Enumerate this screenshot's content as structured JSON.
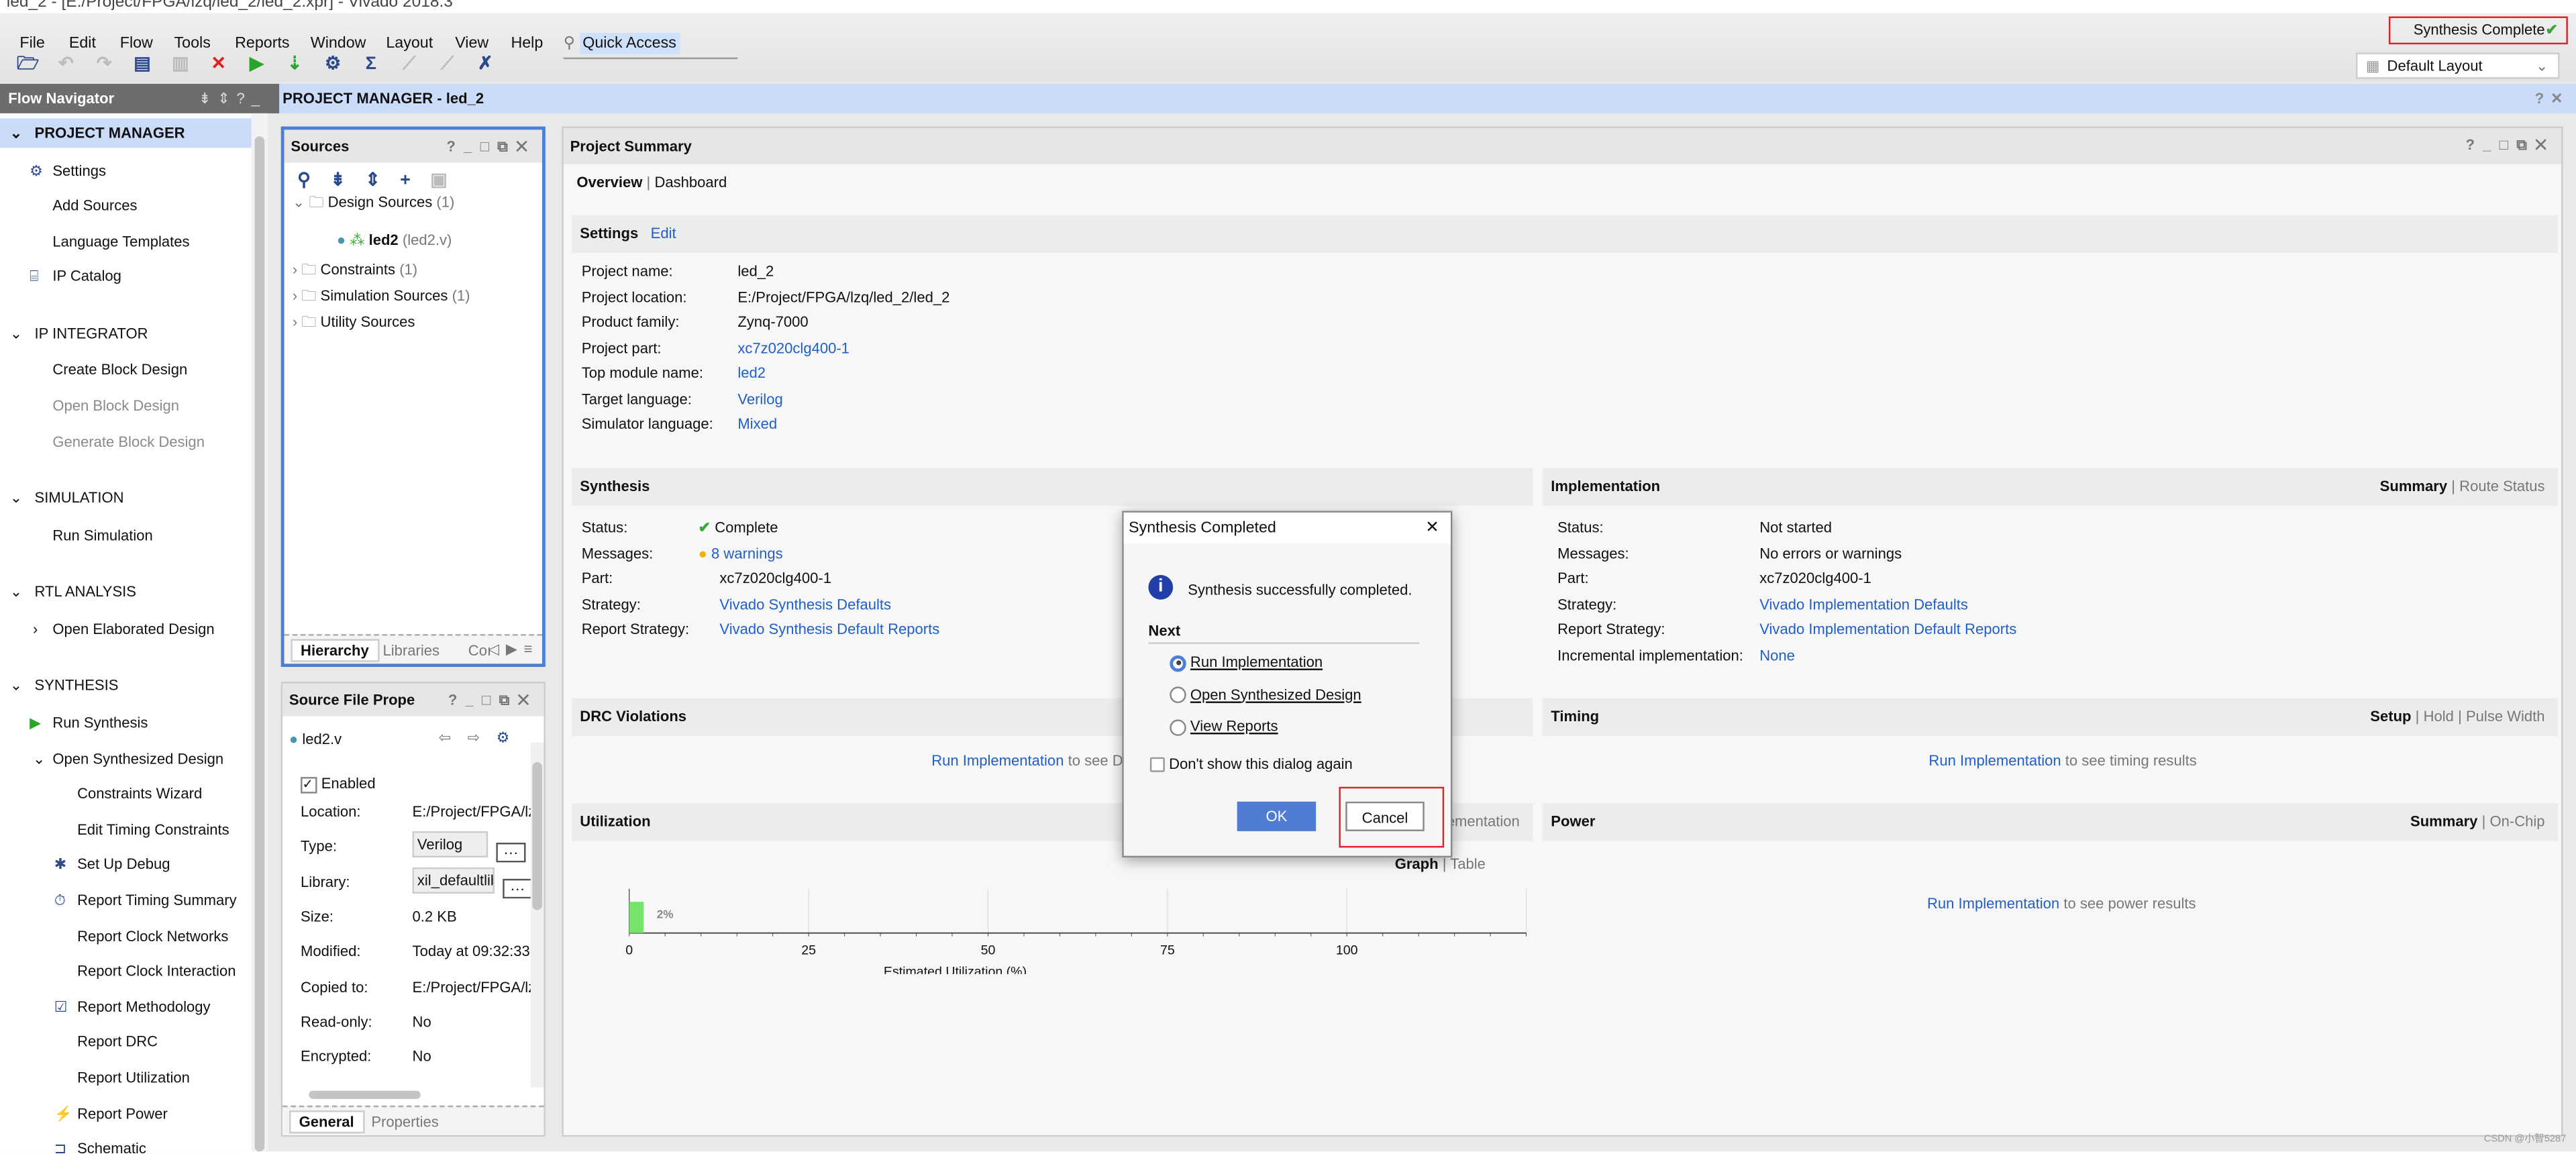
{
  "window": {
    "title": "led_2 - [E:/Project/FPGA/lzq/led_2/led_2.xpr] - Vivado 2018.3"
  },
  "menu": [
    "File",
    "Edit",
    "Flow",
    "Tools",
    "Reports",
    "Window",
    "Layout",
    "View",
    "Help"
  ],
  "quick_access": "Quick Access",
  "toolbar": {
    "icons": [
      "open-project-icon",
      "undo-icon",
      "redo-icon",
      "report-icon",
      "copy-icon",
      "stop-icon",
      "run-icon",
      "program-icon",
      "settings-icon",
      "sigma-icon",
      "auto-connect-icon",
      "unlink-icon",
      "debug-icon"
    ]
  },
  "status": {
    "label": "Synthesis Complete",
    "color": "#3aa63a",
    "highlight": "#e0202a"
  },
  "layout_select": "Default Layout",
  "flow_navigator": {
    "title": "Flow Navigator",
    "sections": [
      {
        "label": "PROJECT MANAGER",
        "items": [
          {
            "label": "Settings",
            "icon": "gear-icon"
          },
          {
            "label": "Add Sources"
          },
          {
            "label": "Language Templates"
          },
          {
            "label": "IP Catalog",
            "icon": "ip-icon"
          }
        ]
      },
      {
        "label": "IP INTEGRATOR",
        "items": [
          {
            "label": "Create Block Design"
          },
          {
            "label": "Open Block Design",
            "disabled": true
          },
          {
            "label": "Generate Block Design",
            "disabled": true
          }
        ]
      },
      {
        "label": "SIMULATION",
        "items": [
          {
            "label": "Run Simulation"
          }
        ]
      },
      {
        "label": "RTL ANALYSIS",
        "items": [
          {
            "label": "Open Elaborated Design"
          }
        ]
      },
      {
        "label": "SYNTHESIS",
        "items": [
          {
            "label": "Run Synthesis"
          },
          {
            "label": "Open Synthesized Design"
          },
          {
            "label": "Constraints Wizard"
          },
          {
            "label": "Edit Timing Constraints"
          },
          {
            "label": "Set Up Debug"
          },
          {
            "label": "Report Timing Summary"
          },
          {
            "label": "Report Clock Networks"
          },
          {
            "label": "Report Clock Interaction"
          },
          {
            "label": "Report Methodology"
          },
          {
            "label": "Report DRC"
          },
          {
            "label": "Report Utilization"
          },
          {
            "label": "Report Power"
          },
          {
            "label": "Schematic"
          }
        ]
      }
    ]
  },
  "main_header": "PROJECT MANAGER - led_2",
  "sources": {
    "title": "Sources",
    "tree": [
      {
        "label": "Design Sources",
        "count": "(1)"
      },
      {
        "label": "led2",
        "sub": "(led2.v)"
      },
      {
        "label": "Constraints",
        "count": "(1)"
      },
      {
        "label": "Simulation Sources",
        "count": "(1)"
      },
      {
        "label": "Utility Sources",
        "count": ""
      }
    ],
    "tabs": [
      "Hierarchy",
      "Libraries",
      "Coı"
    ]
  },
  "file_props": {
    "title": "Source File Prope",
    "file": "led2.v",
    "enabled": "Enabled",
    "rows": [
      [
        "Location:",
        "E:/Project/FPGA/lz"
      ],
      [
        "Type:",
        "Verilog"
      ],
      [
        "Library:",
        "xil_defaultlib"
      ],
      [
        "Size:",
        "0.2 KB"
      ],
      [
        "Modified:",
        "Today at 09:32:33"
      ],
      [
        "Copied to:",
        "E:/Project/FPGA/lz"
      ],
      [
        "Read-only:",
        "No"
      ],
      [
        "Encrypted:",
        "No"
      ]
    ],
    "tabs": [
      "General",
      "Properties"
    ]
  },
  "summary": {
    "title": "Project Summary",
    "tabs": [
      "Overview",
      "Dashboard"
    ],
    "settings": {
      "title": "Settings",
      "edit": "Edit",
      "rows": [
        [
          "Project name:",
          "led_2"
        ],
        [
          "Project location:",
          "E:/Project/FPGA/lzq/led_2/led_2"
        ],
        [
          "Product family:",
          "Zynq-7000"
        ],
        [
          "Project part:",
          "xc7z020clg400-1"
        ],
        [
          "Top module name:",
          "led2"
        ],
        [
          "Target language:",
          "Verilog"
        ],
        [
          "Simulator language:",
          "Mixed"
        ]
      ]
    },
    "synthesis": {
      "title": "Synthesis",
      "rows": [
        [
          "Status:",
          "Complete"
        ],
        [
          "Messages:",
          "8 warnings"
        ],
        [
          "Part:",
          "xc7z020clg400-1"
        ],
        [
          "Strategy:",
          "Vivado Synthesis Defaults"
        ],
        [
          "Report Strategy:",
          "Vivado Synthesis Default Reports"
        ]
      ]
    },
    "implementation": {
      "title": "Implementation",
      "links": [
        "Summary",
        "Route Status"
      ],
      "rows": [
        [
          "Status:",
          "Not started"
        ],
        [
          "Messages:",
          "No errors or warnings"
        ],
        [
          "Part:",
          "xc7z020clg400-1"
        ],
        [
          "Strategy:",
          "Vivado Implementation Defaults"
        ],
        [
          "Report Strategy:",
          "Vivado Implementation Default Reports"
        ],
        [
          "Incremental implementation:",
          "None"
        ]
      ]
    },
    "drc": {
      "title": "DRC Violations",
      "link": "Run Implementation",
      "text": "to see DRC results"
    },
    "timing": {
      "title": "Timing",
      "links": [
        "Setup",
        "Hold",
        "Pulse Width"
      ],
      "link": "Run Implementation",
      "text": "to see timing results"
    },
    "utilization": {
      "title": "Utilization",
      "links": [
        "Graph",
        "Table"
      ],
      "hidden_link": "Post-Implementation"
    },
    "power": {
      "title": "Power",
      "links": [
        "Summary",
        "On-Chip"
      ],
      "link": "Run Implementation",
      "text": "to see power results"
    }
  },
  "chart_data": {
    "type": "bar",
    "orientation": "horizontal",
    "values": [
      2
    ],
    "data_labels": [
      "2%"
    ],
    "xlabel": "Estimated Utilization (%)",
    "xticks": [
      0,
      25,
      50,
      75,
      100
    ],
    "xlim": [
      0,
      125
    ],
    "bar_color": "#76e36a",
    "grid": true
  },
  "dialog": {
    "title": "Synthesis Completed",
    "message": "Synthesis successfully completed.",
    "next": "Next",
    "options": [
      "Run Implementation",
      "Open Synthesized Design",
      "View Reports"
    ],
    "selected": 0,
    "checkbox": "Don't show this dialog again",
    "ok": "OK",
    "cancel": "Cancel",
    "highlight": "#e0202a"
  },
  "watermark": "CSDN @小智5287"
}
